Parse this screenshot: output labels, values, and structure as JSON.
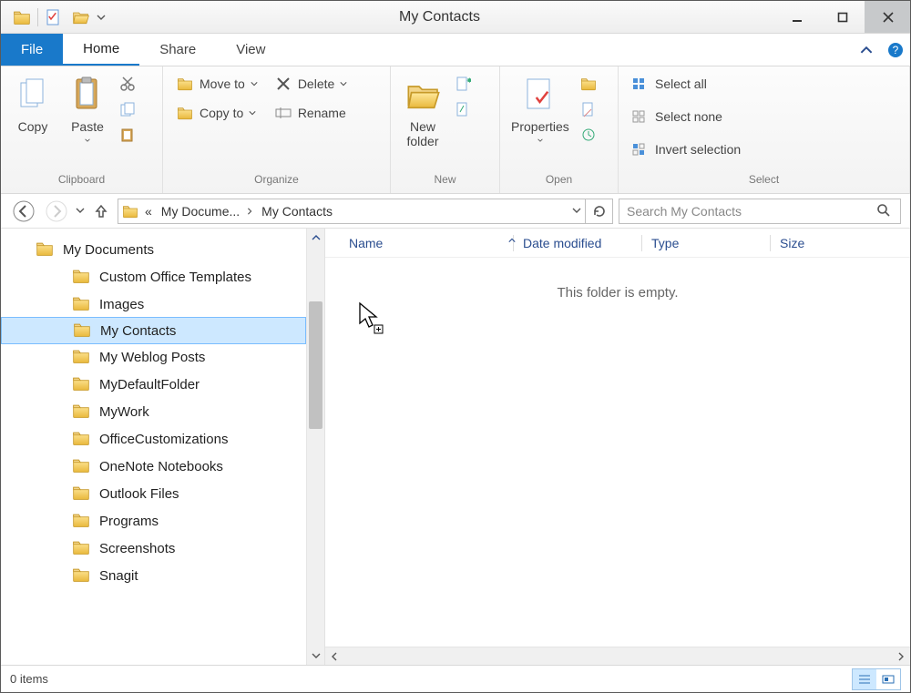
{
  "title": "My Contacts",
  "tabs": {
    "file": "File",
    "home": "Home",
    "share": "Share",
    "view": "View"
  },
  "ribbon": {
    "clipboard": {
      "copy": "Copy",
      "paste": "Paste",
      "label": "Clipboard"
    },
    "organize": {
      "move_to": "Move to",
      "copy_to": "Copy to",
      "delete": "Delete",
      "rename": "Rename",
      "label": "Organize"
    },
    "new": {
      "new_folder_l1": "New",
      "new_folder_l2": "folder",
      "label": "New"
    },
    "open": {
      "properties": "Properties",
      "label": "Open"
    },
    "select": {
      "select_all": "Select all",
      "select_none": "Select none",
      "invert": "Invert selection",
      "label": "Select"
    }
  },
  "breadcrumb": {
    "prefix": "«",
    "p1": "My Docume...",
    "p2": "My Contacts"
  },
  "search": {
    "placeholder": "Search My Contacts"
  },
  "tree": {
    "root": "My Documents",
    "items": [
      "Custom Office Templates",
      "Images",
      "My Contacts",
      "My Weblog Posts",
      "MyDefaultFolder",
      "MyWork",
      "OfficeCustomizations",
      "OneNote Notebooks",
      "Outlook Files",
      "Programs",
      "Screenshots",
      "Snagit"
    ],
    "selected_index": 2
  },
  "columns": {
    "name": "Name",
    "date": "Date modified",
    "type": "Type",
    "size": "Size"
  },
  "empty_message": "This folder is empty.",
  "status": {
    "items": "0 items"
  }
}
